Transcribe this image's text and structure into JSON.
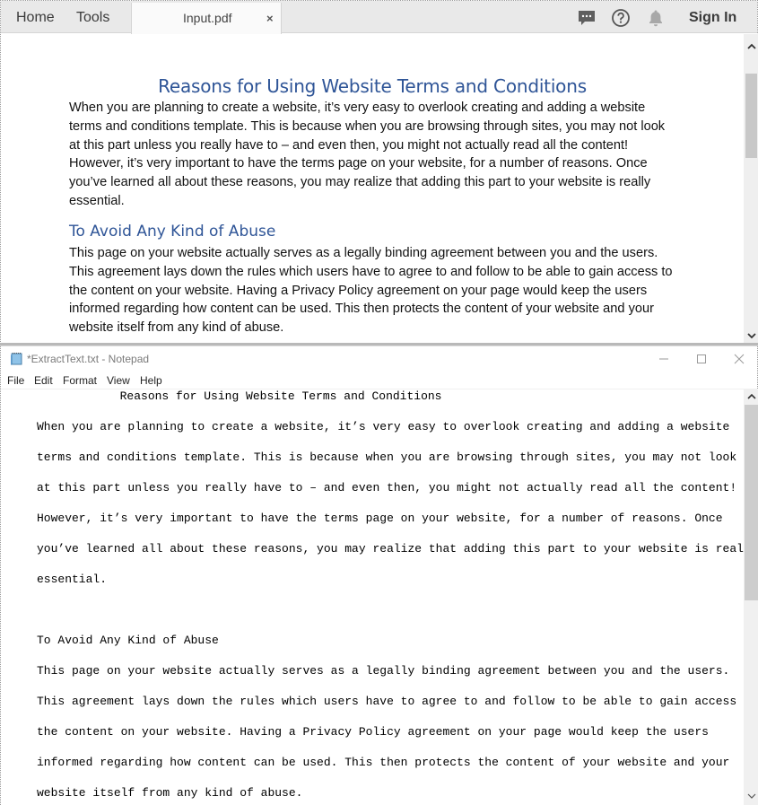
{
  "acrobat": {
    "nav": {
      "home": "Home",
      "tools": "Tools"
    },
    "document_tab": {
      "label": "Input.pdf",
      "close": "×"
    },
    "toolbar_icons": [
      "comment-icon",
      "help-icon",
      "notification-bell-icon"
    ],
    "sign_in": "Sign In",
    "page": {
      "title": "Reasons for Using Website Terms and Conditions",
      "paragraph1": [
        "When you are planning to create a website, it’s very easy to overlook creating and adding a website",
        "terms and conditions template. This is because when you are browsing through sites, you may not look",
        "at this part unless you really have to – and even then, you might not actually read all the content!",
        "However, it’s very important to have the terms page on your website, for a number of reasons. Once",
        "you’ve learned all about these reasons, you may realize that adding this part to your website is really",
        "essential."
      ],
      "heading2": "To Avoid Any Kind of Abuse",
      "paragraph2": [
        "This page on your website actually serves as a legally binding agreement between you and the users.",
        "This agreement lays down the rules which users have to agree to and follow to be able to gain access to",
        "the content on your website. Having a Privacy Policy agreement on your page would keep the users",
        "informed regarding how content can be used. This then protects the content of your website and your",
        "website itself from any kind of abuse."
      ]
    },
    "scrollbar": {
      "up": "˄",
      "down": "˅"
    }
  },
  "notepad": {
    "title": "*ExtractText.txt - Notepad",
    "window_controls": {
      "minimize": "minimize-icon",
      "maximize": "maximize-icon",
      "close": "close-icon"
    },
    "menu": [
      "File",
      "Edit",
      "Format",
      "View",
      "Help"
    ],
    "lines": [
      "                 Reasons for Using Website Terms and Conditions",
      "When you are planning to create a website, it’s very easy to overlook creating and adding a website",
      "terms and conditions template. This is because when you are browsing through sites, you may not look",
      "at this part unless you really have to – and even then, you might not actually read all the content!",
      "However, it’s very important to have the terms page on your website, for a number of reasons. Once",
      "you’ve learned all about these reasons, you may realize that adding this part to your website is really",
      "essential.",
      "",
      "To Avoid Any Kind of Abuse",
      "This page on your website actually serves as a legally binding agreement between you and the users.",
      "This agreement lays down the rules which users have to agree to and follow to be able to gain access to",
      "the content on your website. Having a Privacy Policy agreement on your page would keep the users",
      "informed regarding how content can be used. This then protects the content of your website and your",
      "website itself from any kind of abuse."
    ],
    "scrollbar": {
      "up": "˄",
      "down": "˅"
    }
  }
}
